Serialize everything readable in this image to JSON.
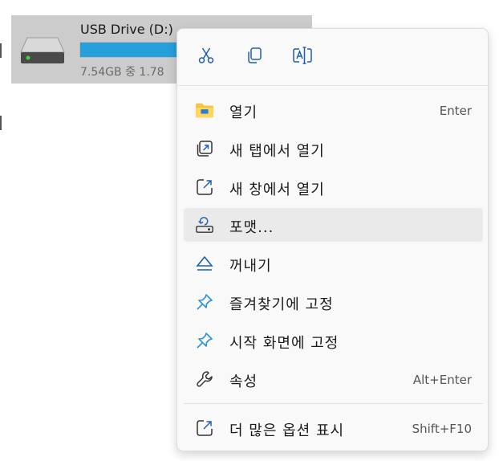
{
  "drive": {
    "name": "USB Drive (D:)",
    "space_text": "7.54GB 중 1.78",
    "usage_fraction": 0.82,
    "icon": "usb-drive-icon"
  },
  "quick_actions": [
    {
      "icon": "cut-icon"
    },
    {
      "icon": "copy-icon"
    },
    {
      "icon": "rename-icon"
    }
  ],
  "menu": {
    "items": [
      {
        "label": "열기",
        "shortcut": "Enter",
        "icon": "folder-icon"
      },
      {
        "label": "새 탭에서 열기",
        "shortcut": "",
        "icon": "new-tab-icon"
      },
      {
        "label": "새 창에서 열기",
        "shortcut": "",
        "icon": "new-window-icon"
      },
      {
        "label": "포맷...",
        "shortcut": "",
        "icon": "format-drive-icon"
      },
      {
        "label": "꺼내기",
        "shortcut": "",
        "icon": "eject-icon"
      },
      {
        "label": "즐겨찾기에 고정",
        "shortcut": "",
        "icon": "pin-icon"
      },
      {
        "label": "시작 화면에 고정",
        "shortcut": "",
        "icon": "pin-icon"
      },
      {
        "label": "속성",
        "shortcut": "Alt+Enter",
        "icon": "wrench-icon"
      }
    ],
    "more": {
      "label": "더 많은 옵션 표시",
      "shortcut": "Shift+F10",
      "icon": "more-options-icon"
    }
  },
  "colors": {
    "accent": "#26a0da",
    "folder_yellow": "#f4c542",
    "pin_blue": "#2f8fd8",
    "hover_bg": "#eaeaea"
  }
}
